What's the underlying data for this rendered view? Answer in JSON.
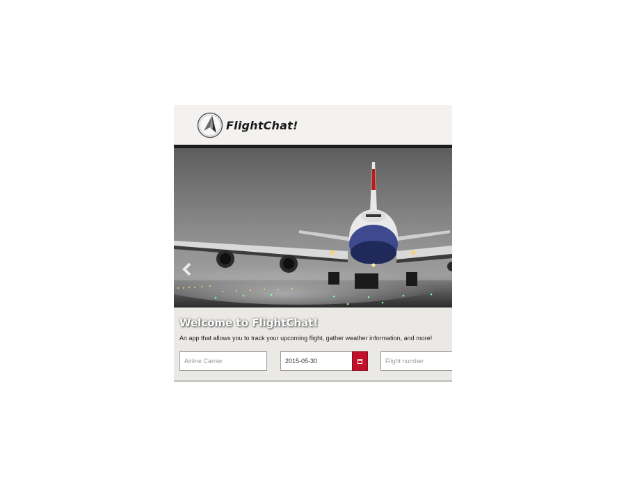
{
  "header": {
    "brand": "FlightChat!",
    "logo_icon": "paper-plane-icon"
  },
  "carousel": {
    "prev_icon": "chevron-left-icon",
    "slide_count": 3,
    "active_slide": 1
  },
  "hero_text": {
    "title": "Welcome to FlightChat!",
    "description": "An app that allows you to track your upcoming flight, gather weather information, and more!"
  },
  "form": {
    "airline_placeholder": "Airline Carrier",
    "date_value": "2015-05-30",
    "calendar_icon": "calendar-icon",
    "flight_placeholder": "Flight number"
  },
  "colors": {
    "accent": "#c0102a",
    "header_bg": "#f3f2f0",
    "content_bg": "#ebe9e5"
  }
}
